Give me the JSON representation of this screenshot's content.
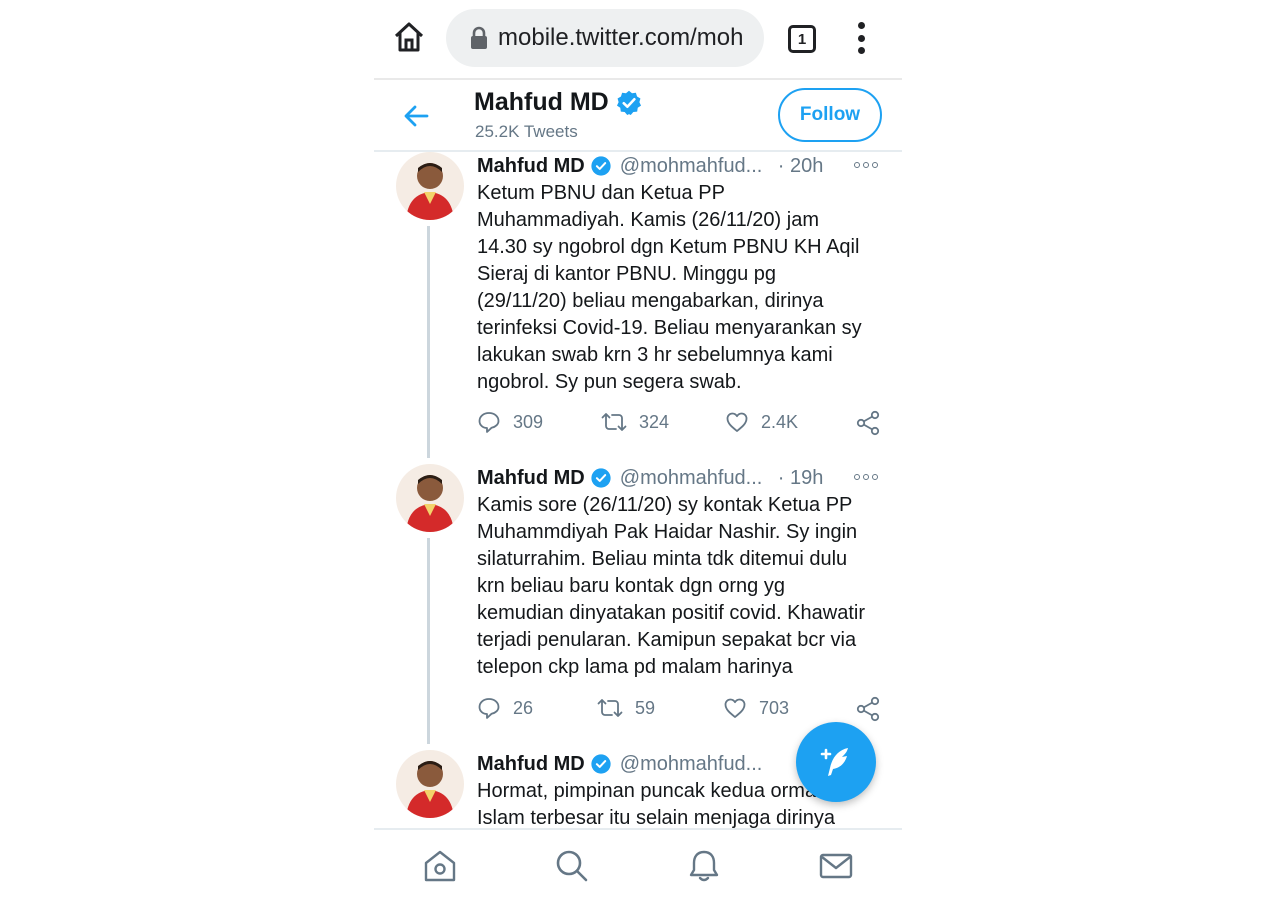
{
  "browser": {
    "url": "mobile.twitter.com/moh",
    "tab_count": "1"
  },
  "header": {
    "name": "Mahfud MD",
    "tweet_count": "25.2K Tweets",
    "follow_label": "Follow"
  },
  "tweets": [
    {
      "name": "Mahfud MD",
      "handle": "@mohmahfud...",
      "time": "· 20h",
      "text": "Ketum PBNU dan Ketua PP\nMuhammadiyah. Kamis (26/11/20) jam\n14.30 sy ngobrol dgn Ketum PBNU KH Aqil\nSieraj di kantor PBNU. Minggu pg\n(29/11/20) beliau mengabarkan, dirinya\nterinfeksi Covid-19. Beliau menyarankan sy\nlakukan swab krn 3 hr sebelumnya kami\nngobrol. Sy pun segera swab.",
      "replies": "309",
      "retweets": "324",
      "likes": "2.4K"
    },
    {
      "name": "Mahfud MD",
      "handle": "@mohmahfud...",
      "time": "· 19h",
      "text": "Kamis sore (26/11/20) sy kontak Ketua PP\nMuhammdiyah Pak Haidar Nashir. Sy ingin\nsilaturrahim. Beliau minta tdk ditemui dulu\nkrn beliau baru kontak dgn orng yg\nkemudian dinyatakan positif covid. Khawatir\nterjadi penularan. Kamipun sepakat bcr via\ntelepon ckp lama pd malam harinya",
      "replies": "26",
      "retweets": "59",
      "likes": "703"
    },
    {
      "name": "Mahfud MD",
      "handle": "@mohmahfud...",
      "text": "Hormat, pimpinan puncak kedua ormas\nIslam terbesar itu selain menjaga dirinya"
    }
  ],
  "colors": {
    "accent": "#1da1f2",
    "muted": "#657786",
    "text": "#14171a",
    "divider": "#e6ecf0"
  },
  "icons": [
    "home-icon",
    "lock-icon",
    "back-arrow-icon",
    "verified-icon",
    "more-icon",
    "reply-icon",
    "retweet-icon",
    "like-icon",
    "share-icon",
    "compose-icon",
    "home-nav-icon",
    "search-icon",
    "notifications-icon",
    "messages-icon"
  ]
}
